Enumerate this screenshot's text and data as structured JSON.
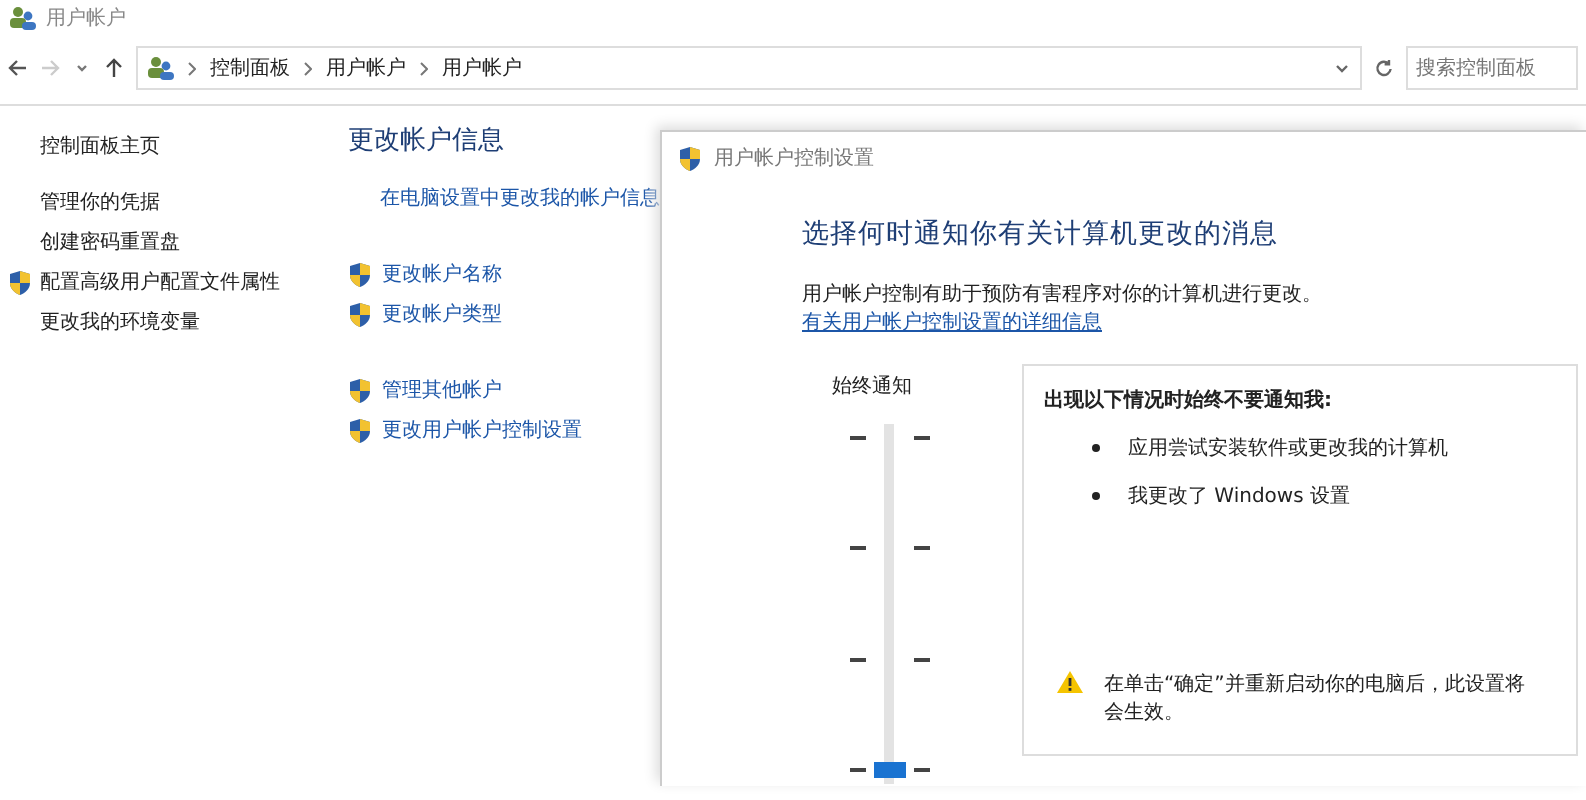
{
  "window": {
    "title": "用户帐户"
  },
  "address_bar": {
    "breadcrumbs": [
      "控制面板",
      "用户帐户",
      "用户帐户"
    ]
  },
  "search": {
    "placeholder": "搜索控制面板"
  },
  "sidebar": {
    "items": [
      {
        "label": "控制面板主页",
        "shield": false
      },
      {
        "label": "管理你的凭据",
        "shield": false
      },
      {
        "label": "创建密码重置盘",
        "shield": false
      },
      {
        "label": "配置高级用户配置文件属性",
        "shield": true
      },
      {
        "label": "更改我的环境变量",
        "shield": false
      }
    ]
  },
  "main": {
    "heading": "更改帐户信息",
    "groups": [
      [
        {
          "label": "在电脑设置中更改我的帐户信息",
          "shield": false
        }
      ],
      [
        {
          "label": "更改帐户名称",
          "shield": true
        },
        {
          "label": "更改帐户类型",
          "shield": true
        }
      ],
      [
        {
          "label": "管理其他帐户",
          "shield": true
        },
        {
          "label": "更改用户帐户控制设置",
          "shield": true
        }
      ]
    ]
  },
  "dialog": {
    "title": "用户帐户控制设置",
    "heading": "选择何时通知你有关计算机更改的消息",
    "description": "用户帐户控制有助于预防有害程序对你的计算机进行更改。",
    "link": "有关用户帐户控制设置的详细信息",
    "slider": {
      "top_label": "始终通知",
      "level": 0
    },
    "info": {
      "title": "出现以下情况时始终不要通知我:",
      "bullets": [
        "应用尝试安装软件或更改我的计算机",
        "我更改了 Windows 设置"
      ],
      "warning": "在单击“确定”并重新启动你的电脑后，此设置将会生效。"
    }
  }
}
